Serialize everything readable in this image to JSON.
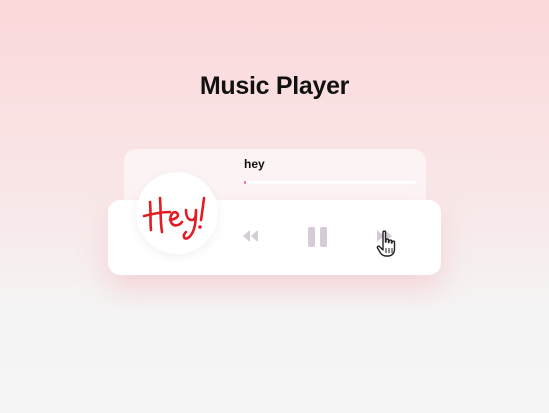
{
  "page": {
    "title": "Music Player"
  },
  "player": {
    "track_title": "hey",
    "progress_fraction": 0.01,
    "album_art_text": "Hey!",
    "state": "playing",
    "controls": {
      "previous": "rewind-icon",
      "pause": "pause-icon",
      "next": "fast-forward-icon"
    }
  },
  "colors": {
    "background_top": "#fbd8da",
    "background_bottom": "#f5f5f5",
    "progress_fill": "#ff6b7a",
    "control_icons": "#d6ccd8",
    "album_text": "#e11d22"
  }
}
